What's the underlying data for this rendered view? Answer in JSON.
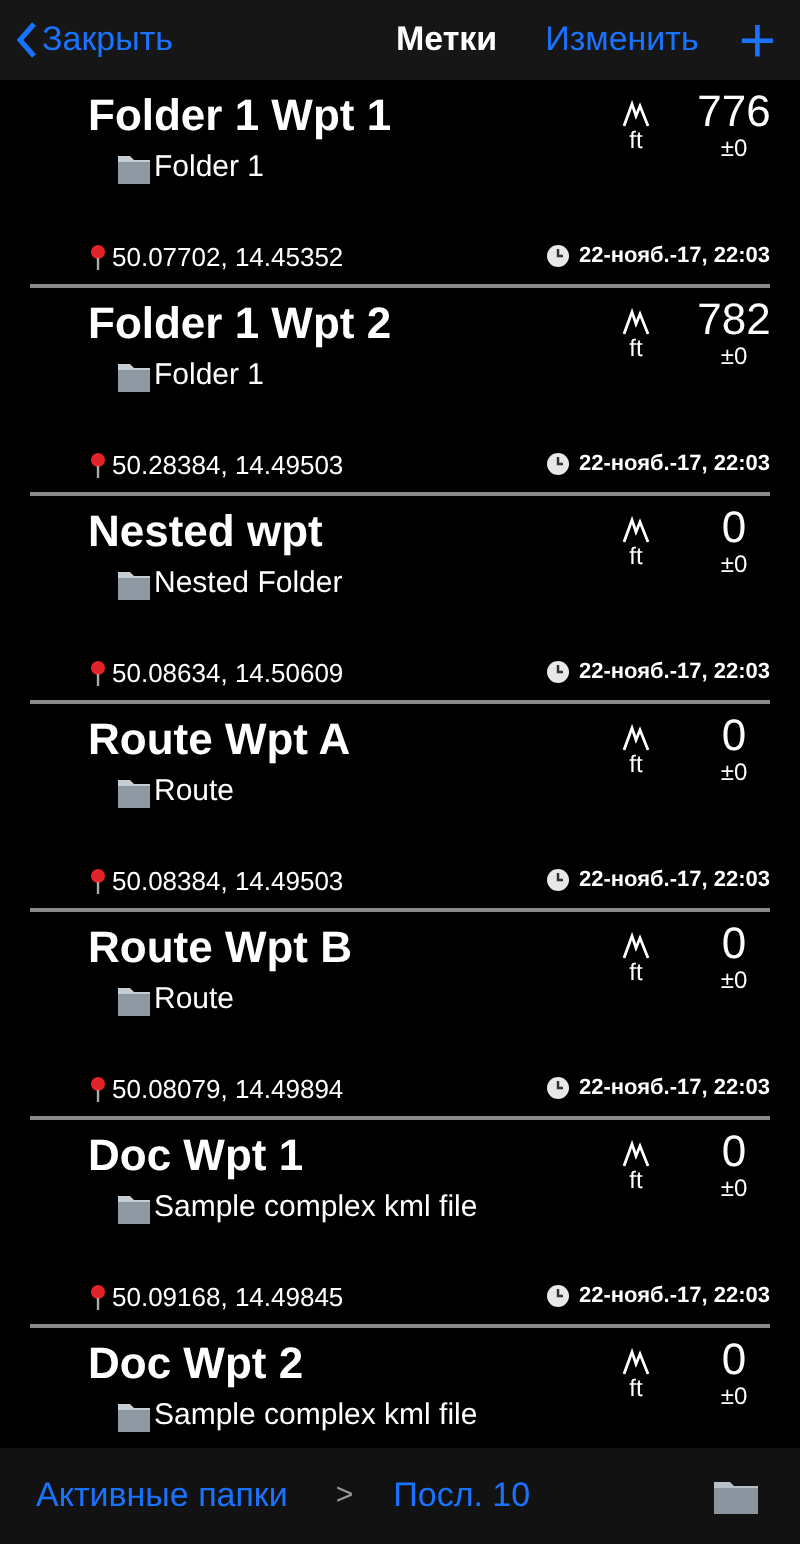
{
  "nav": {
    "back": "Закрыть",
    "title": "Метки",
    "edit": "Изменить",
    "add": "+"
  },
  "waypoints": [
    {
      "name": "Folder 1 Wpt 1",
      "folder": "Folder 1",
      "unit": "ft",
      "elevation": "776",
      "accuracy": "±0",
      "coords": "50.07702, 14.45352",
      "time": "22-нояб.-17, 22:03"
    },
    {
      "name": "Folder 1 Wpt 2",
      "folder": "Folder 1",
      "unit": "ft",
      "elevation": "782",
      "accuracy": "±0",
      "coords": "50.28384, 14.49503",
      "time": "22-нояб.-17, 22:03"
    },
    {
      "name": "Nested wpt",
      "folder": "Nested Folder",
      "unit": "ft",
      "elevation": "0",
      "accuracy": "±0",
      "coords": "50.08634, 14.50609",
      "time": "22-нояб.-17, 22:03"
    },
    {
      "name": "Route Wpt A",
      "folder": "Route",
      "unit": "ft",
      "elevation": "0",
      "accuracy": "±0",
      "coords": "50.08384, 14.49503",
      "time": "22-нояб.-17, 22:03"
    },
    {
      "name": "Route Wpt B",
      "folder": "Route",
      "unit": "ft",
      "elevation": "0",
      "accuracy": "±0",
      "coords": "50.08079, 14.49894",
      "time": "22-нояб.-17, 22:03"
    },
    {
      "name": "Doc Wpt 1",
      "folder": "Sample complex kml file",
      "unit": "ft",
      "elevation": "0",
      "accuracy": "±0",
      "coords": "50.09168, 14.49845",
      "time": "22-нояб.-17, 22:03"
    },
    {
      "name": "Doc Wpt 2",
      "folder": "Sample complex kml file",
      "unit": "ft",
      "elevation": "0",
      "accuracy": "±0"
    }
  ],
  "toolbar": {
    "active_folders": "Активные папки",
    "separator": ">",
    "recent": "Посл. 10"
  }
}
